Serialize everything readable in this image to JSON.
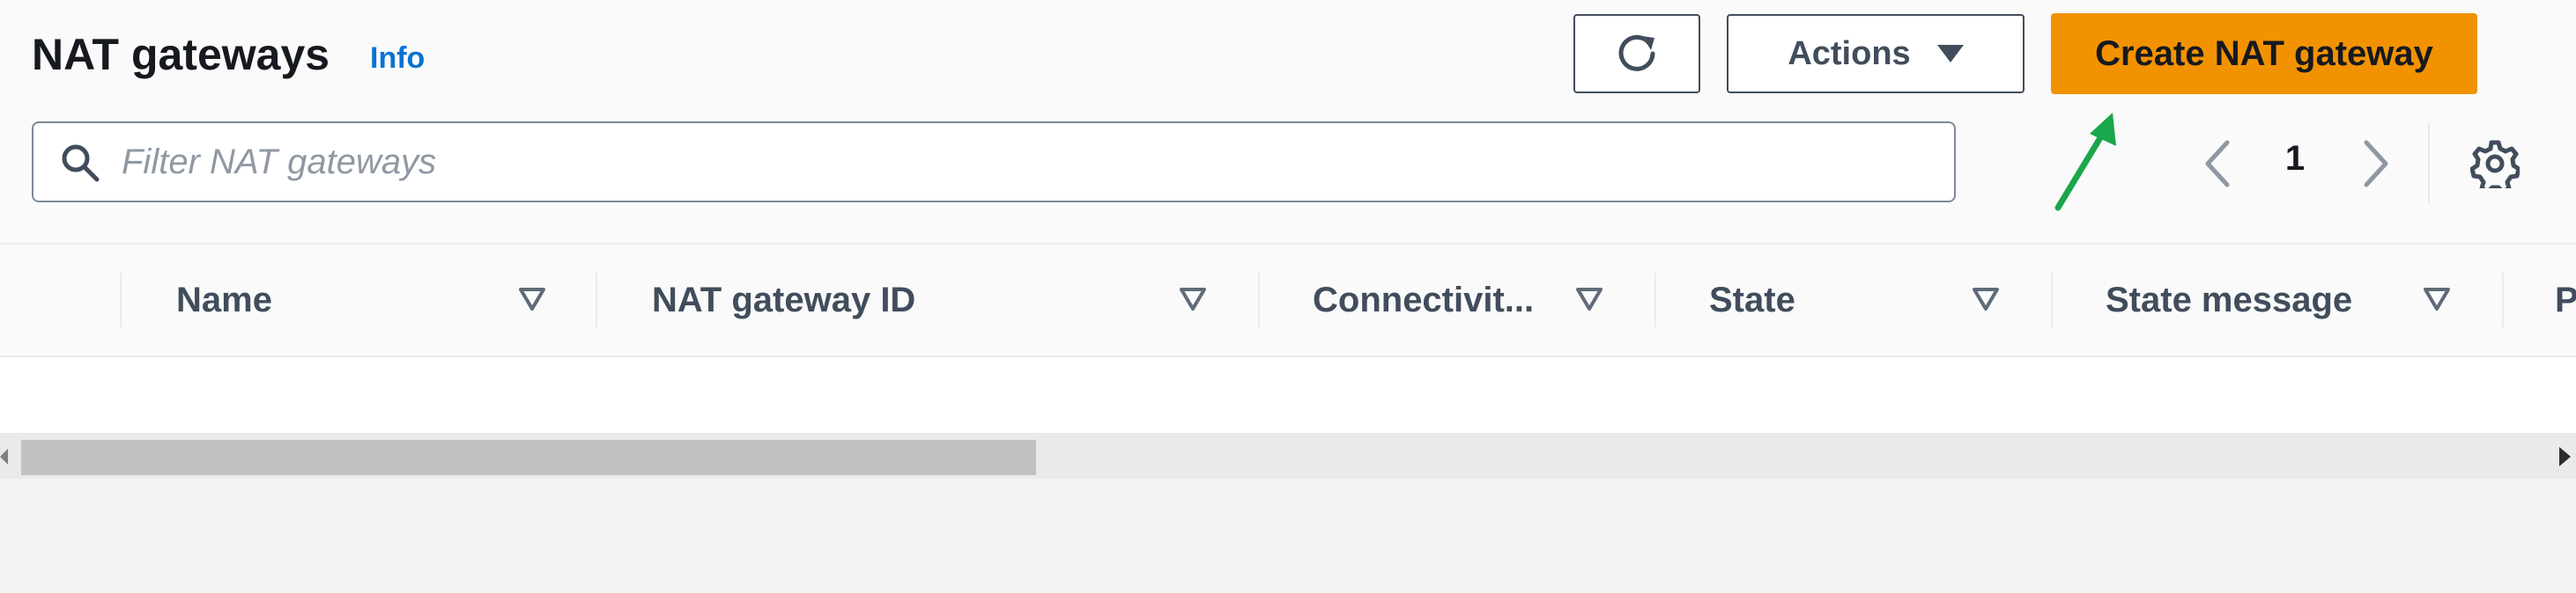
{
  "header": {
    "title": "NAT gateways",
    "info_label": "Info"
  },
  "toolbar": {
    "refresh_icon": "refresh-icon",
    "actions_label": "Actions",
    "create_label": "Create NAT gateway"
  },
  "search": {
    "placeholder": "Filter NAT gateways",
    "value": ""
  },
  "pagination": {
    "current_page": "1"
  },
  "table": {
    "columns": [
      {
        "label": "Name"
      },
      {
        "label": "NAT gateway ID"
      },
      {
        "label": "Connectivit..."
      },
      {
        "label": "State"
      },
      {
        "label": "State message"
      },
      {
        "label": "P"
      }
    ],
    "rows": []
  },
  "colors": {
    "primary_button": "#f39200",
    "link": "#0972d3",
    "annotation_arrow": "#1aa64a"
  }
}
